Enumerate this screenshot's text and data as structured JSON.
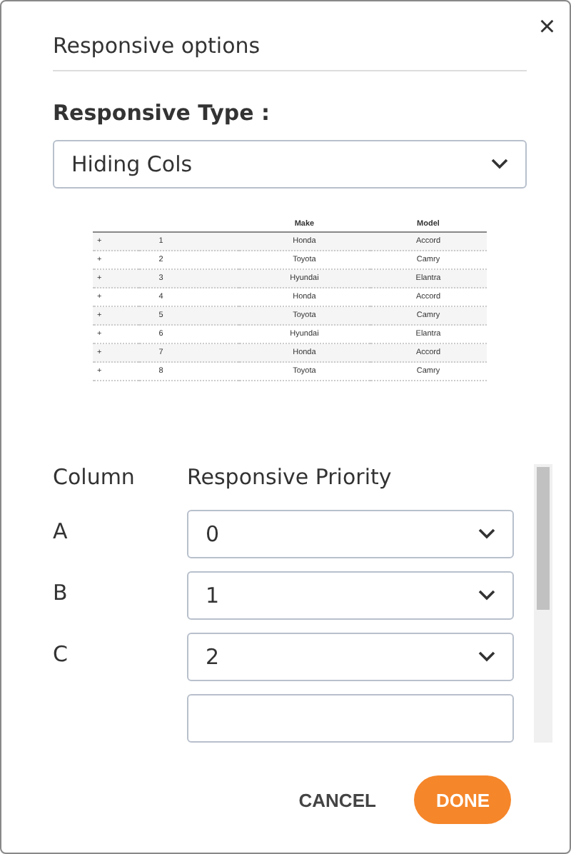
{
  "dialog": {
    "title": "Responsive options",
    "close": "×"
  },
  "responsive_type": {
    "label": "Responsive Type :",
    "value": "Hiding Cols"
  },
  "preview_table": {
    "columns": [
      "",
      "",
      "Make",
      "Model"
    ],
    "rows": [
      [
        "+",
        "1",
        "Honda",
        "Accord"
      ],
      [
        "+",
        "2",
        "Toyota",
        "Camry"
      ],
      [
        "+",
        "3",
        "Hyundai",
        "Elantra"
      ],
      [
        "+",
        "4",
        "Honda",
        "Accord"
      ],
      [
        "+",
        "5",
        "Toyota",
        "Camry"
      ],
      [
        "+",
        "6",
        "Hyundai",
        "Elantra"
      ],
      [
        "+",
        "7",
        "Honda",
        "Accord"
      ],
      [
        "+",
        "8",
        "Toyota",
        "Camry"
      ]
    ]
  },
  "priorities": {
    "headers": [
      "Column",
      "Responsive Priority"
    ],
    "rows": [
      {
        "column": "A",
        "value": "0"
      },
      {
        "column": "B",
        "value": "1"
      },
      {
        "column": "C",
        "value": "2"
      },
      {
        "column": "",
        "value": ""
      }
    ]
  },
  "buttons": [
    {
      "label": "CANCEL",
      "kind": "text"
    },
    {
      "label": "DONE",
      "kind": "primary"
    }
  ]
}
